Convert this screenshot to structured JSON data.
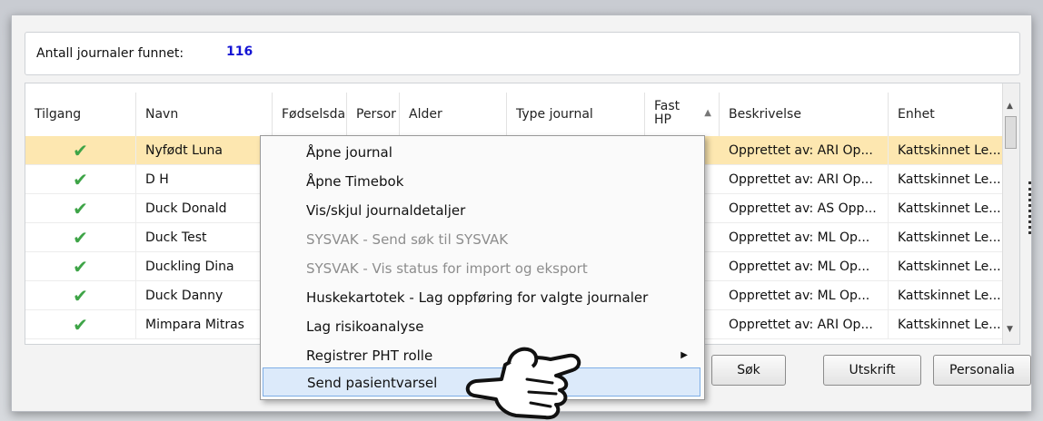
{
  "summary": {
    "label": "Antall journaler funnet:",
    "value": "116"
  },
  "columns": [
    "Tilgang",
    "Navn",
    "Fødselsda",
    "Persor",
    "Alder",
    "Type journal",
    "Fast HP",
    "Beskrivelse",
    "Enhet"
  ],
  "rows": [
    {
      "access": "✔",
      "name": "Nyfødt Luna",
      "desc": "Opprettet av: ARI Op...",
      "unit": "Kattskinnet Le...",
      "selected": true
    },
    {
      "access": "✔",
      "name": "D H",
      "desc": "Opprettet av: ARI Op...",
      "unit": "Kattskinnet Le..."
    },
    {
      "access": "✔",
      "name": "Duck Donald",
      "desc": "Opprettet av: AS Opp...",
      "unit": "Kattskinnet Le..."
    },
    {
      "access": "✔",
      "name": "Duck Test",
      "desc": "Opprettet av: ML Op...",
      "unit": "Kattskinnet Le..."
    },
    {
      "access": "✔",
      "name": "Duckling Dina",
      "desc": "Opprettet av: ML Op...",
      "unit": "Kattskinnet Le..."
    },
    {
      "access": "✔",
      "name": "Duck Danny",
      "desc": "Opprettet av: ML Op...",
      "unit": "Kattskinnet Le..."
    },
    {
      "access": "✔",
      "name": "Mimpara Mitras",
      "desc": "Opprettet av: ARI Op...",
      "unit": "Kattskinnet Le..."
    }
  ],
  "buttons": {
    "search": "Søk",
    "print": "Utskrift",
    "personalia": "Personalia"
  },
  "context_menu": [
    {
      "label": "Åpne journal"
    },
    {
      "label": "Åpne Timebok"
    },
    {
      "label": "Vis/skjul journaldetaljer"
    },
    {
      "label": "SYSVAK - Send søk til SYSVAK",
      "disabled": true
    },
    {
      "label": "SYSVAK - Vis status for import og eksport",
      "disabled": true
    },
    {
      "label": "Huskekartotek - Lag oppføring for valgte journaler"
    },
    {
      "label": "Lag risikoanalyse"
    },
    {
      "label": "Registrer PHT rolle",
      "submenu": true
    },
    {
      "label": "Send pasientvarsel",
      "hover": true
    }
  ],
  "icons": {
    "check": "check-icon",
    "sort": "sort-asc-icon",
    "pointer": "pointing-hand-icon"
  },
  "colors": {
    "selected_row": "#fde7b0",
    "check": "#3ea447",
    "count_value": "#1515d4",
    "menu_hover": "#dceafa"
  }
}
